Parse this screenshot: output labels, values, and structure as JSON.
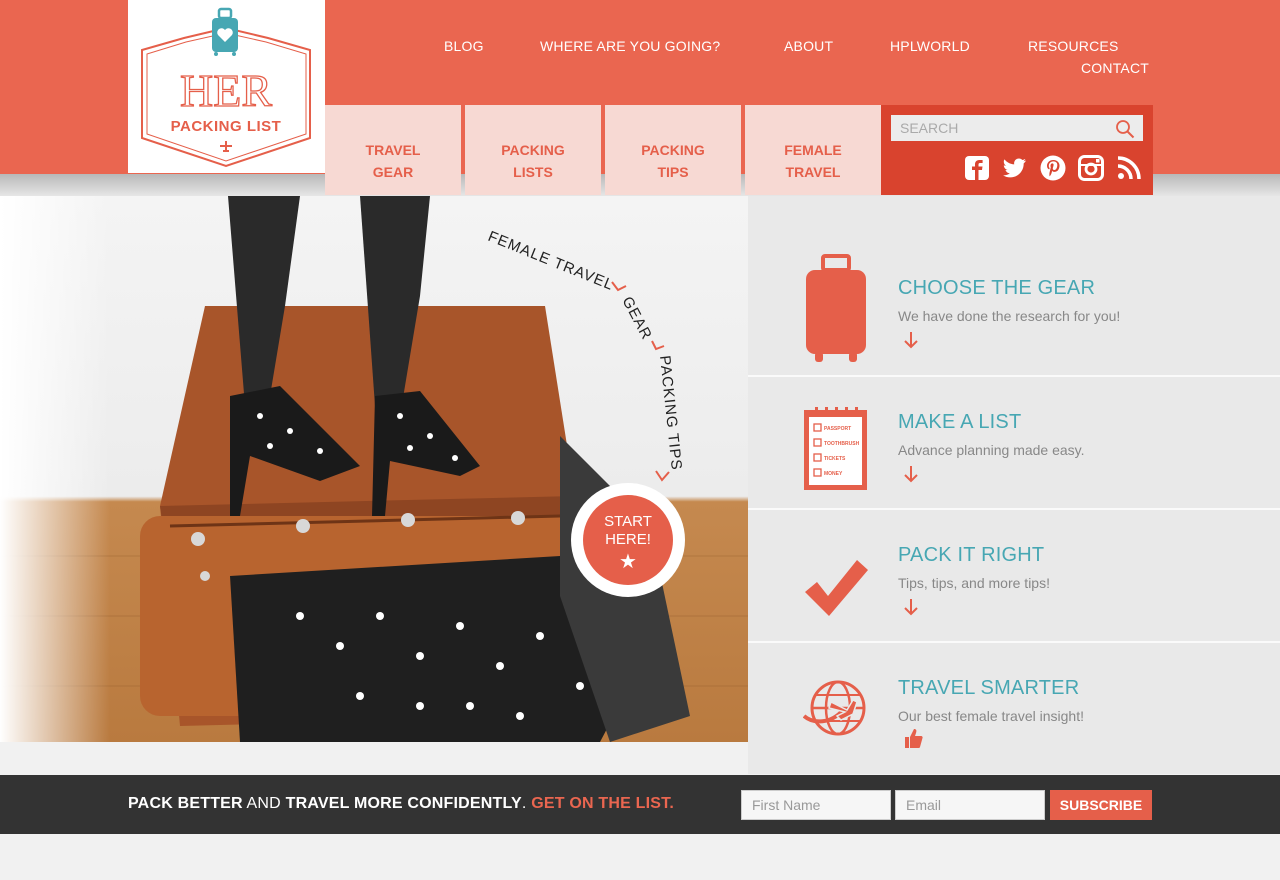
{
  "brand": {
    "logo_line1": "HER",
    "logo_line2": "PACKING LIST"
  },
  "topnav": {
    "blog": "BLOG",
    "where": "WHERE ARE YOU GOING?",
    "about": "ABOUT",
    "hplworld": "HPLWORLD",
    "resources": "RESOURCES",
    "contact": "CONTACT"
  },
  "tabs": [
    {
      "line1": "TRAVEL",
      "line2": "GEAR"
    },
    {
      "line1": "PACKING",
      "line2": "LISTS"
    },
    {
      "line1": "PACKING",
      "line2": "TIPS"
    },
    {
      "line1": "FEMALE",
      "line2": "TRAVEL"
    }
  ],
  "search": {
    "placeholder": "SEARCH"
  },
  "social_icons": [
    "facebook-icon",
    "twitter-icon",
    "pinterest-icon",
    "instagram-icon",
    "rss-icon"
  ],
  "hero": {
    "arc_text1": "FEMALE TRAVEL",
    "arc_text2": "GEAR",
    "arc_text3": "PACKING TIPS",
    "start_line1": "START",
    "start_line2": "HERE!",
    "star": "★"
  },
  "features": [
    {
      "title": "CHOOSE THE GEAR",
      "desc": "We have done the research for you!",
      "icon": "suitcase-icon",
      "action": "arrow-down-icon"
    },
    {
      "title": "MAKE A LIST",
      "desc": "Advance planning made easy.",
      "icon": "checklist-icon",
      "action": "arrow-down-icon",
      "list_items": [
        "PASSPORT",
        "TOOTHBRUSH",
        "TICKETS",
        "MONEY"
      ]
    },
    {
      "title": "PACK IT RIGHT",
      "desc": "Tips, tips, and more tips!",
      "icon": "checkmark-icon",
      "action": "arrow-down-icon"
    },
    {
      "title": "TRAVEL SMARTER",
      "desc": "Our best female travel insight!",
      "icon": "globe-plane-icon",
      "action": "thumbs-up-icon"
    }
  ],
  "newsletter": {
    "part1": "PACK BETTER",
    "part2": " AND ",
    "part3": "TRAVEL MORE CONFIDENTLY",
    "part4": ". ",
    "cta": "GET ON THE LIST.",
    "first_name_placeholder": "First Name",
    "email_placeholder": "Email",
    "subscribe_label": "SUBSCRIBE"
  },
  "colors": {
    "brand_coral": "#ea6650",
    "tab_bg": "#f7d9d3",
    "teal": "#47a7b3",
    "dark_bar": "#333333",
    "search_panel": "#d9432e"
  }
}
